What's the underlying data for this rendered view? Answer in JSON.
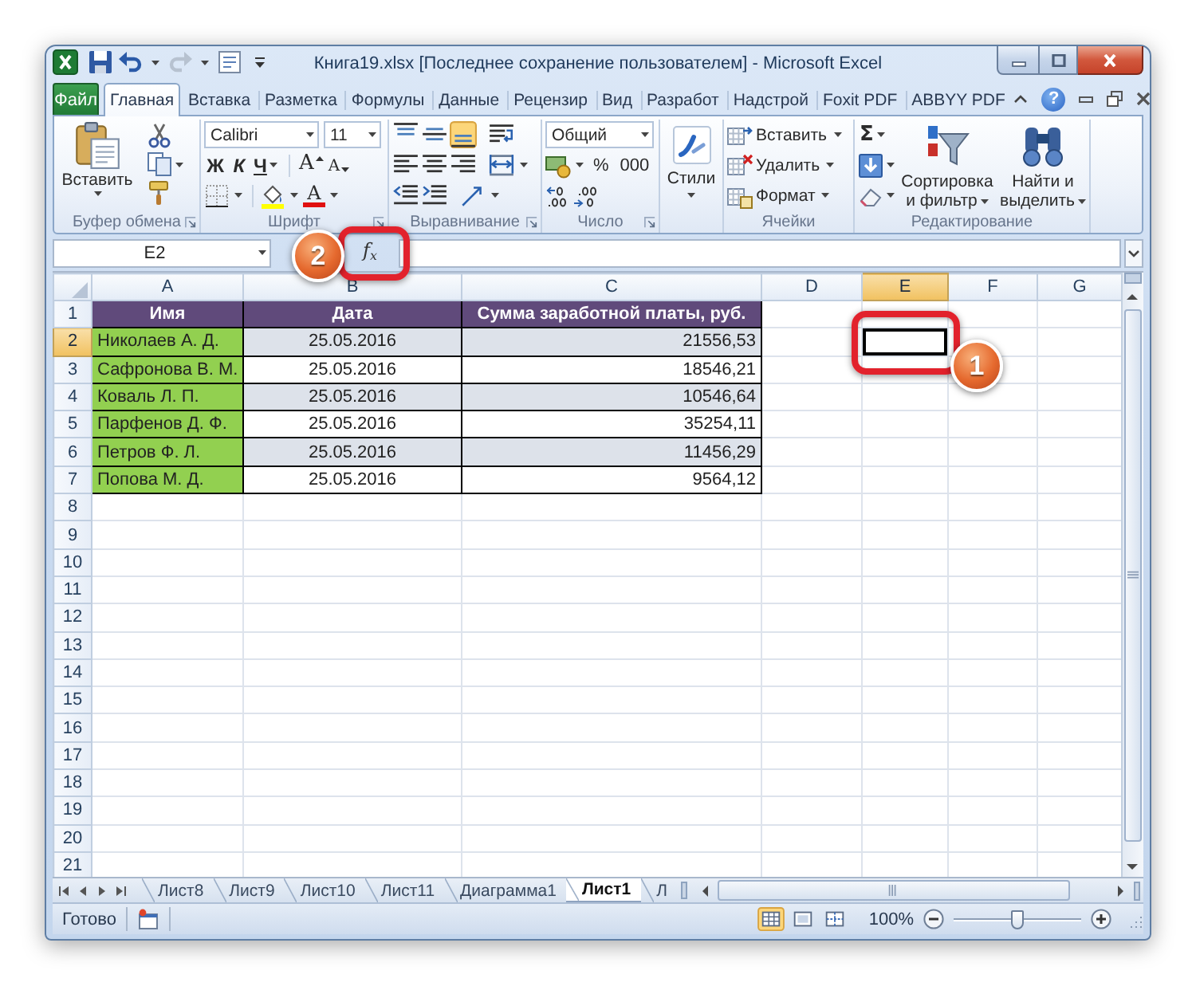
{
  "window": {
    "title": "Книга19.xlsx [Последнее сохранение пользователем] - Microsoft Excel"
  },
  "ribbon_tabs": [
    {
      "label": "Файл",
      "kind": "file",
      "selected": false
    },
    {
      "label": "Главная",
      "kind": "tab",
      "selected": true
    },
    {
      "label": "Вставка",
      "kind": "tab",
      "selected": false
    },
    {
      "label": "Разметка",
      "kind": "tab",
      "selected": false
    },
    {
      "label": "Формулы",
      "kind": "tab",
      "selected": false
    },
    {
      "label": "Данные",
      "kind": "tab",
      "selected": false
    },
    {
      "label": "Рецензир",
      "kind": "tab",
      "selected": false
    },
    {
      "label": "Вид",
      "kind": "tab",
      "selected": false
    },
    {
      "label": "Разработ",
      "kind": "tab",
      "selected": false
    },
    {
      "label": "Надстрой",
      "kind": "tab",
      "selected": false
    },
    {
      "label": "Foxit PDF",
      "kind": "tab",
      "selected": false
    },
    {
      "label": "ABBYY PDF",
      "kind": "tab",
      "selected": false
    }
  ],
  "ribbon_help": "?",
  "ribbon": {
    "clipboard": {
      "label": "Буфер обмена",
      "paste": "Вставить"
    },
    "font": {
      "label": "Шрифт",
      "font_name": "Calibri",
      "font_size": "11",
      "bold": "Ж",
      "italic": "К",
      "underline": "Ч",
      "grow_font": "A",
      "shrink_font": "A",
      "font_color": "A"
    },
    "alignment": {
      "label": "Выравнивание",
      "rows": [
        [
          {
            "kind": "top",
            "on": false
          },
          {
            "kind": "middle",
            "on": false
          },
          {
            "kind": "bottom",
            "on": true
          },
          {
            "kind": "wrap",
            "on": false
          }
        ],
        [
          {
            "kind": "left",
            "on": false
          },
          {
            "kind": "center",
            "on": false
          },
          {
            "kind": "right",
            "on": false
          },
          {
            "kind": "merge",
            "on": false
          }
        ],
        [
          {
            "kind": "outdent",
            "on": false
          },
          {
            "kind": "indent",
            "on": false
          },
          {
            "kind": "orientation",
            "on": false
          }
        ]
      ]
    },
    "number": {
      "label": "Число",
      "format": "Общий",
      "percent": "%",
      "thousands": "000"
    },
    "styles": {
      "button": "Стили"
    },
    "cells": {
      "label": "Ячейки",
      "buttons": [
        {
          "label": "Вставить",
          "kind": "insert"
        },
        {
          "label": "Удалить",
          "kind": "delete"
        },
        {
          "label": "Формат",
          "kind": "format"
        }
      ]
    },
    "editing": {
      "label": "Редактирование",
      "sum": "Σ",
      "sort": "Сортировка и фильтр",
      "find": "Найти и выделить"
    }
  },
  "formula_bar": {
    "name_box": "E2",
    "function_button": "f$_{x}$",
    "callout": "2"
  },
  "sheet": {
    "columns": [
      {
        "label": "A",
        "selected": false
      },
      {
        "label": "B",
        "selected": false
      },
      {
        "label": "C",
        "selected": false
      },
      {
        "label": "D",
        "selected": false
      },
      {
        "label": "E",
        "selected": true
      },
      {
        "label": "F",
        "selected": false
      },
      {
        "label": "G",
        "selected": false
      }
    ],
    "rows": [
      {
        "number": "1",
        "selected": false,
        "cells": [
          {
            "kind": "header",
            "text": "Имя"
          },
          {
            "kind": "header",
            "text": "Дата"
          },
          {
            "kind": "header",
            "text": "Сумма заработной платы, руб."
          }
        ]
      },
      {
        "number": "2",
        "selected": true,
        "shaded": true,
        "cells": [
          {
            "kind": "name",
            "text": "Николаев А. Д."
          },
          {
            "kind": "date",
            "text": "25.05.2016"
          },
          {
            "kind": "amount",
            "text": "21556,53"
          }
        ]
      },
      {
        "number": "3",
        "selected": false,
        "shaded": false,
        "cells": [
          {
            "kind": "name",
            "text": "Сафронова В. М."
          },
          {
            "kind": "date",
            "text": "25.05.2016"
          },
          {
            "kind": "amount",
            "text": "18546,21"
          }
        ]
      },
      {
        "number": "4",
        "selected": false,
        "shaded": true,
        "cells": [
          {
            "kind": "name",
            "text": "Коваль Л. П."
          },
          {
            "kind": "date",
            "text": "25.05.2016"
          },
          {
            "kind": "amount",
            "text": "10546,64"
          }
        ]
      },
      {
        "number": "5",
        "selected": false,
        "shaded": false,
        "cells": [
          {
            "kind": "name",
            "text": "Парфенов Д. Ф."
          },
          {
            "kind": "date",
            "text": "25.05.2016"
          },
          {
            "kind": "amount",
            "text": "35254,11"
          }
        ]
      },
      {
        "number": "6",
        "selected": false,
        "shaded": true,
        "cells": [
          {
            "kind": "name",
            "text": "Петров Ф. Л."
          },
          {
            "kind": "date",
            "text": "25.05.2016"
          },
          {
            "kind": "amount",
            "text": "11456,29"
          }
        ]
      },
      {
        "number": "7",
        "selected": false,
        "shaded": false,
        "cells": [
          {
            "kind": "name",
            "text": "Попова М. Д."
          },
          {
            "kind": "date",
            "text": "25.05.2016"
          },
          {
            "kind": "amount",
            "text": "9564,12"
          }
        ]
      },
      {
        "number": "8",
        "selected": false
      },
      {
        "number": "9",
        "selected": false
      },
      {
        "number": "10",
        "selected": false
      },
      {
        "number": "11",
        "selected": false
      },
      {
        "number": "12",
        "selected": false
      },
      {
        "number": "13",
        "selected": false
      },
      {
        "number": "14",
        "selected": false
      },
      {
        "number": "15",
        "selected": false
      },
      {
        "number": "16",
        "selected": false
      },
      {
        "number": "17",
        "selected": false
      },
      {
        "number": "18",
        "selected": false
      },
      {
        "number": "19",
        "selected": false
      },
      {
        "number": "20",
        "selected": false
      },
      {
        "number": "21",
        "selected": false
      }
    ],
    "callout": "1"
  },
  "sheet_tabs": [
    {
      "label": "Лист8",
      "selected": false
    },
    {
      "label": "Лист9",
      "selected": false
    },
    {
      "label": "Лист10",
      "selected": false
    },
    {
      "label": "Лист11",
      "selected": false
    },
    {
      "label": "Диаграмма1",
      "selected": false
    },
    {
      "label": "Лист1",
      "selected": true
    },
    {
      "label": "Л",
      "selected": false
    }
  ],
  "status_bar": {
    "status": "Готово",
    "views": [
      {
        "kind": "normal",
        "selected": true
      },
      {
        "kind": "page_layout",
        "selected": false
      },
      {
        "kind": "page_break",
        "selected": false
      }
    ],
    "zoom": "100%",
    "zoom_slider": {
      "level": 0.5
    }
  }
}
